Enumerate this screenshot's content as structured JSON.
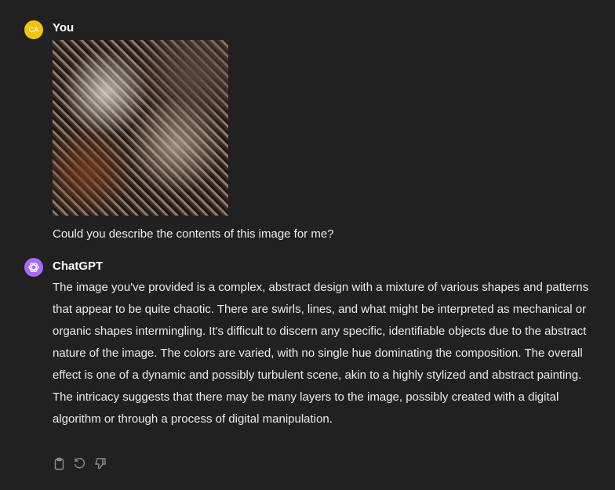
{
  "user": {
    "initials": "CA",
    "name": "You",
    "avatar_color": "#f1c40f",
    "prompt": "Could you describe the contents of this image for me?"
  },
  "assistant": {
    "name": "ChatGPT",
    "avatar_color": "#ab68ff",
    "response": "The image you've provided is a complex, abstract design with a mixture of various shapes and patterns that appear to be quite chaotic. There are swirls, lines, and what might be interpreted as mechanical or organic shapes intermingling. It's difficult to discern any specific, identifiable objects due to the abstract nature of the image. The colors are varied, with no single hue dominating the composition. The overall effect is one of a dynamic and possibly turbulent scene, akin to a highly stylized and abstract painting. The intricacy suggests that there may be many layers to the image, possibly created with a digital algorithm or through a process of digital manipulation.",
    "actions": [
      "clipboard-icon",
      "regenerate-icon",
      "thumbs-down-icon"
    ]
  },
  "colors": {
    "background": "#212121"
  }
}
